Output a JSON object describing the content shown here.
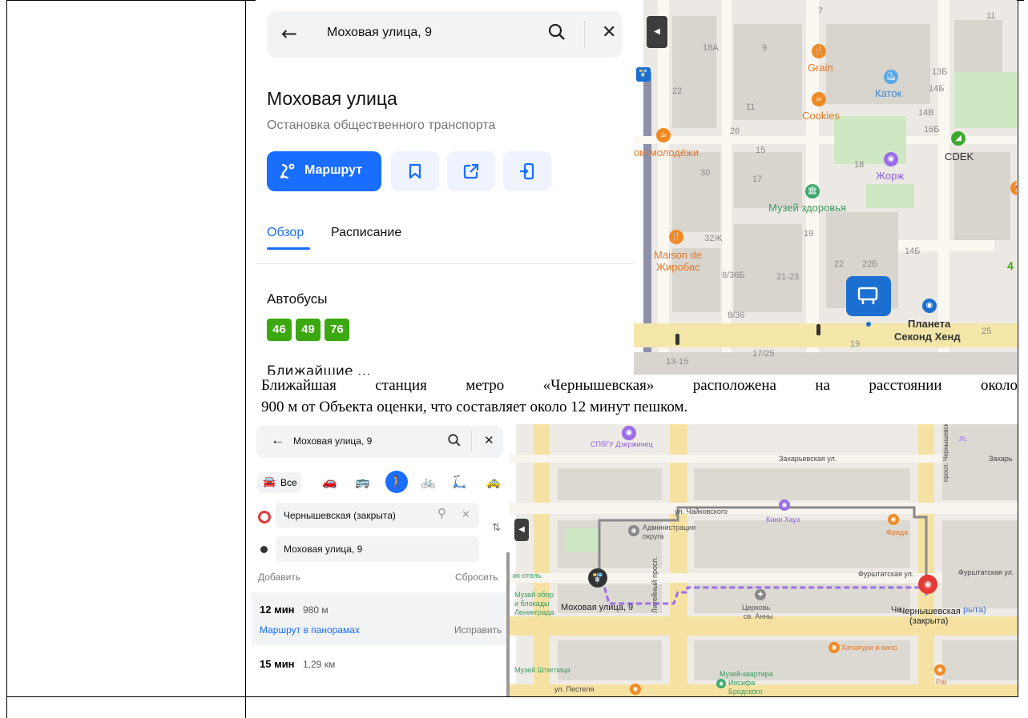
{
  "card": {
    "search_query": "Моховая улица, 9",
    "title": "Моховая улица",
    "subtitle": "Остановка общественного транспорта",
    "route_label": "Маршрут",
    "tab_overview": "Обзор",
    "tab_schedule": "Расписание",
    "buses_title": "Автобусы",
    "buses": [
      "46",
      "49",
      "76"
    ],
    "cut_line": "Ближайшие …"
  },
  "map1": {
    "poi": {
      "grain": "Grain",
      "katok": "Каток",
      "cookies": "Cookies",
      "cdek": "CDEK",
      "dom": "ом молодёжи",
      "zhorzh": "Жорж",
      "museum": "Музей здоровья",
      "maison1": "Maison de",
      "maison2": "Жиробас",
      "planeta1": "Планета",
      "planeta2": "Секонд Хенд"
    },
    "numbers": [
      "7",
      "11",
      "18А",
      "9",
      "13Б",
      "22",
      "14Б",
      "11",
      "14В",
      "26",
      "16Б",
      "15",
      "30",
      "17",
      "18",
      "32Ж",
      "19",
      "22",
      "22Б",
      "14Б",
      "8/36Б",
      "21-23",
      "8/36",
      "19",
      "25",
      "13-15",
      "17/25",
      "4"
    ]
  },
  "paragraph": {
    "line1": "Ближайшая станция метро «Чернышевская» расположена на расстоянии около",
    "line2": "900 м от Объекта оценки, что составляет около 12 минут пешком."
  },
  "route": {
    "search_query": "Моховая улица, 9",
    "mode_all": "Все",
    "from": "Чернышевская (закрыта)",
    "to": "Моховая улица, 9",
    "add": "Добавить",
    "reset": "Сбросить",
    "r1_time": "12 мин",
    "r1_dist": "980 м",
    "r1_pano": "Маршрут в панорамах",
    "r1_fix": "Исправить",
    "r2_time": "15 мин",
    "r2_dist": "1,29 км"
  },
  "map2": {
    "labels": {
      "spbgu": "СПбГУ Дзержинец",
      "zakh": "Захарьевская ул.",
      "zakh2": "Захарь",
      "chaik": "ул. Чайковского",
      "kino": "Кино Хауз",
      "adm1": "Администрация",
      "adm2": "округа",
      "frida": "Фрида",
      "furs1": "Фурштатская ул.",
      "furs2": "Фурштатская ул.",
      "hotel": "ик-отель",
      "mus1": "Музей обор",
      "mus2": "и блокады",
      "mus3": "Ленинграда",
      "mokh": "Моховая улица, 9",
      "church1": "Церковь",
      "church2": "св. Анны",
      "chern1": "Чернышевская",
      "chern2": "(закрыта)",
      "chern_ghost": "Че",
      "chern_ghost2": "рыта)",
      "liteyny": "Литейный просп.",
      "khach": "Хачапури и вино",
      "shtig": "Музей Штиглица",
      "brod1": "Музей-квартира",
      "brod2": "Иосифа",
      "brod3": "Бродского",
      "par": "Par",
      "pest": "ул. Пестеля",
      "chern_prosp": "просп. Чернышевского",
      "jfc": "Jfc"
    }
  },
  "colors": {
    "accent": "#196dff",
    "bus_green": "#3aa80e",
    "route_purple": "#9b6ee8",
    "metro_red": "#e53935"
  }
}
